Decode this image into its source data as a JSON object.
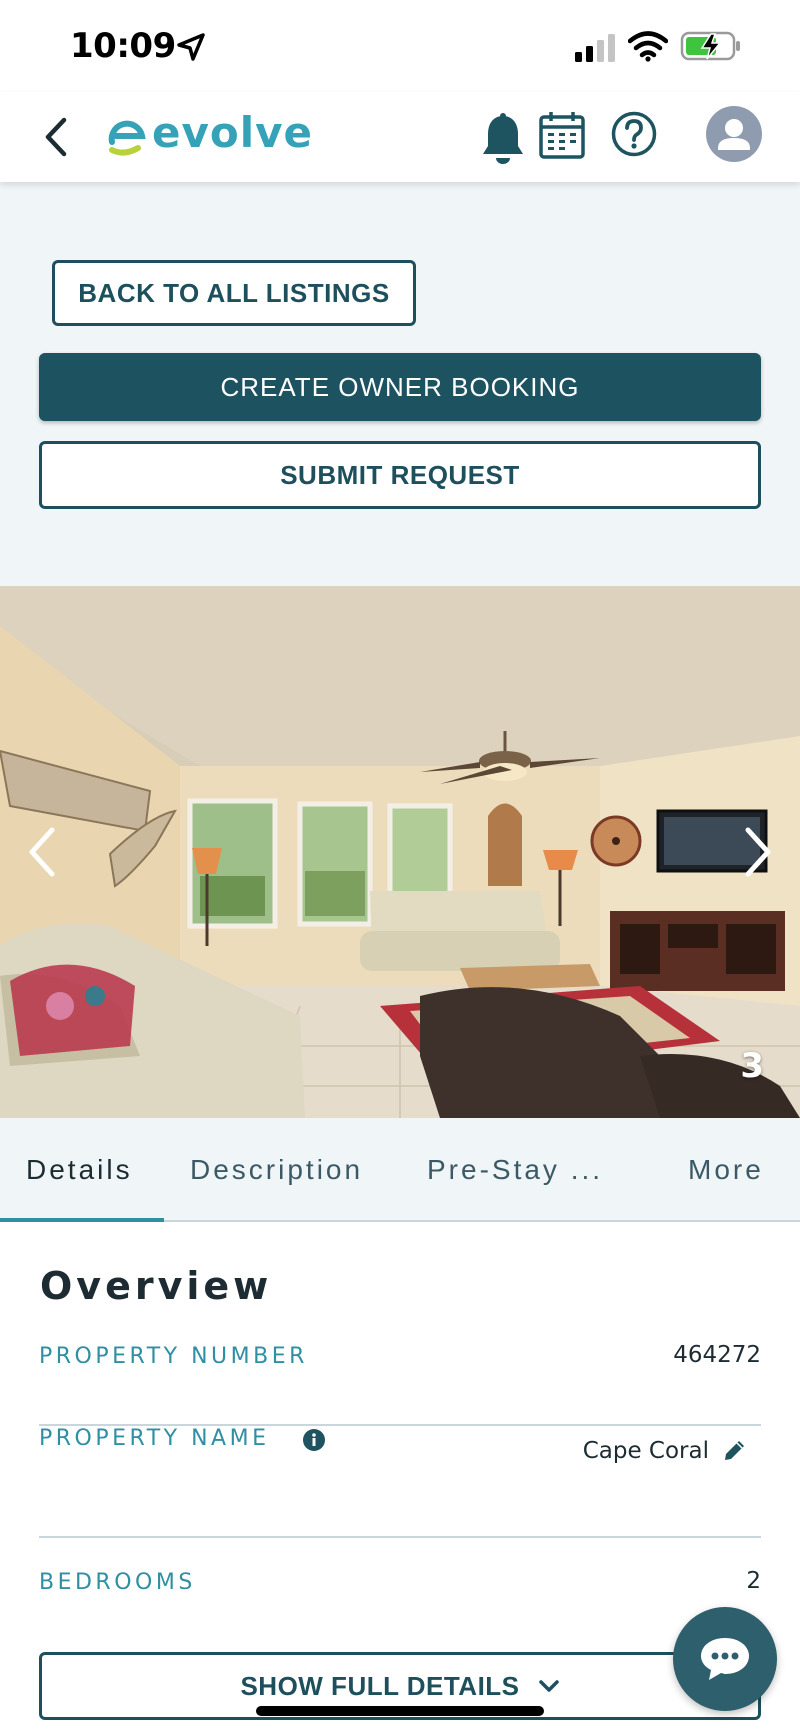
{
  "status_bar": {
    "time": "10:09"
  },
  "header": {
    "logo_text": "evolve",
    "brand_color": "#35a2b8",
    "icons": [
      "back-chevron-icon",
      "bell-icon",
      "calendar-icon",
      "help-icon",
      "avatar-icon"
    ]
  },
  "actions": {
    "back_to_listings": "BACK TO ALL LISTINGS",
    "create_owner_booking": "CREATE OWNER BOOKING",
    "submit_request": "SUBMIT REQUEST"
  },
  "carousel": {
    "photo_number": "3"
  },
  "tabs": [
    {
      "label": "Details",
      "active": true
    },
    {
      "label": "Description",
      "active": false
    },
    {
      "label": "Pre-Stay ...",
      "active": false
    },
    {
      "label": "More",
      "active": false
    }
  ],
  "overview": {
    "title": "Overview",
    "rows": [
      {
        "label": "PROPERTY NUMBER",
        "value": "464272"
      },
      {
        "label": "PROPERTY NAME",
        "value": "Cape Coral"
      },
      {
        "label": "BEDROOMS",
        "value": "2"
      }
    ],
    "show_full_details": "SHOW FULL DETAILS"
  },
  "colors": {
    "primary_dark": "#1d5361",
    "accent_teal": "#2f8fa3",
    "page_bg": "#f0f6f8"
  }
}
